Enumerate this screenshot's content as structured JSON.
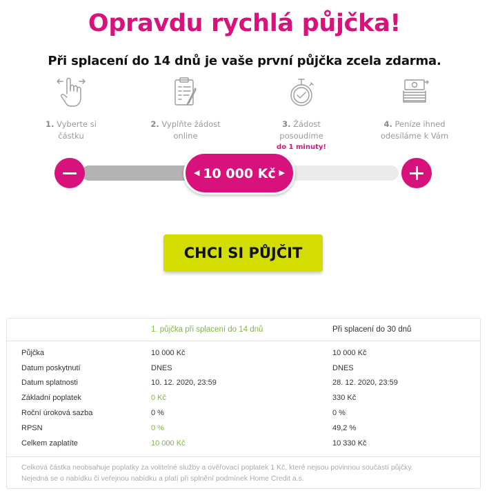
{
  "title": "Opravdu rychlá půjčka!",
  "subtitle": "Při splacení do 14 dnů je vaše první půjčka zcela zdarma.",
  "steps": [
    {
      "num": "1.",
      "line1": "Vyberte si",
      "line2": "částku",
      "icon": "hand-swipe-icon"
    },
    {
      "num": "2.",
      "line1": "Vyplňte žádost",
      "line2": "online",
      "icon": "clipboard-form-icon"
    },
    {
      "num": "3.",
      "line1": "Žádost",
      "line2": "posoudíme",
      "highlight": "do 1 minuty!",
      "icon": "stopwatch-icon"
    },
    {
      "num": "4.",
      "line1": "Peníze ihned",
      "line2": "odesíláme k Vám",
      "icon": "money-stack-icon"
    }
  ],
  "slider": {
    "amount": "10 000 Kč",
    "fraction": 0.42,
    "accent": "#d8127d"
  },
  "cta_label": "CHCI SI PŮJČIT",
  "table": {
    "headers": [
      "1. půjčka při splacení do 14 dnů",
      "Při splacení do 30 dnů"
    ],
    "rows": [
      {
        "label": "Půjčka",
        "a": "10 000 Kč",
        "b": "10 000 Kč",
        "a_green": false
      },
      {
        "label": "Datum poskytnutí",
        "a": "DNES",
        "b": "DNES",
        "a_green": false
      },
      {
        "label": "Datum splatnosti",
        "a": "10. 12. 2020, 23:59",
        "b": "28. 12. 2020, 23:59",
        "a_green": false
      },
      {
        "label": "Základní poplatek",
        "a": "0 Kč",
        "b": "330 Kč",
        "a_green": true
      },
      {
        "label": "Roční úroková sazba",
        "a": "0 %",
        "b": "0 %",
        "a_green": false
      },
      {
        "label": "RPSN",
        "a": "0 %",
        "b": "49,2 %",
        "a_green": true
      },
      {
        "label": "Celkem zaplatíte",
        "a": "10 000 Kč",
        "b": "10 330 Kč",
        "a_green": true
      }
    ],
    "note_line1": "Celková částka neobsahuje poplatky za volitelné služby a ověřovací poplatek 1 Kč, které nejsou povinnou součástí půjčky.",
    "note_line2": "Nejedná se o nabídku či veřejnou nabídku a platí při splnění podmínek Home Credit a.s."
  },
  "colors": {
    "brand": "#d8127d",
    "cta": "#d4dd02",
    "green": "#7dba3a"
  }
}
